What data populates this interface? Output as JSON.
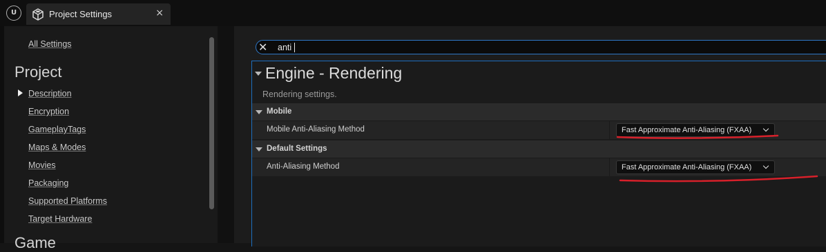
{
  "window": {
    "tab_title": "Project Settings",
    "close_glyph": "×",
    "logo_text": "U",
    "icons": [
      "unreal-logo-icon",
      "project-settings-icon",
      "close-icon"
    ]
  },
  "sidebar": {
    "all_settings": "All Settings",
    "project_heading": "Project",
    "items": [
      {
        "label": "Description",
        "expanded_arrow": true
      },
      {
        "label": "Encryption"
      },
      {
        "label": "GameplayTags"
      },
      {
        "label": "Maps & Modes"
      },
      {
        "label": "Movies"
      },
      {
        "label": "Packaging"
      },
      {
        "label": "Supported Platforms"
      },
      {
        "label": "Target Hardware"
      }
    ],
    "next_heading": "Game"
  },
  "search": {
    "value": "anti",
    "clear_icon": "close-icon",
    "clear_glyph": "✕"
  },
  "section": {
    "title": "Engine - Rendering",
    "description": "Rendering settings.",
    "categories": [
      {
        "name": "Mobile",
        "properties": [
          {
            "label": "Mobile Anti-Aliasing Method",
            "value": "Fast Approximate Anti-Aliasing (FXAA)"
          }
        ]
      },
      {
        "name": "Default Settings",
        "properties": [
          {
            "label": "Anti-Aliasing Method",
            "value": "Fast Approximate Anti-Aliasing (FXAA)"
          }
        ]
      }
    ]
  },
  "colors": {
    "accent_blue": "#1e6fbf",
    "annotation_red": "#d8202a"
  }
}
